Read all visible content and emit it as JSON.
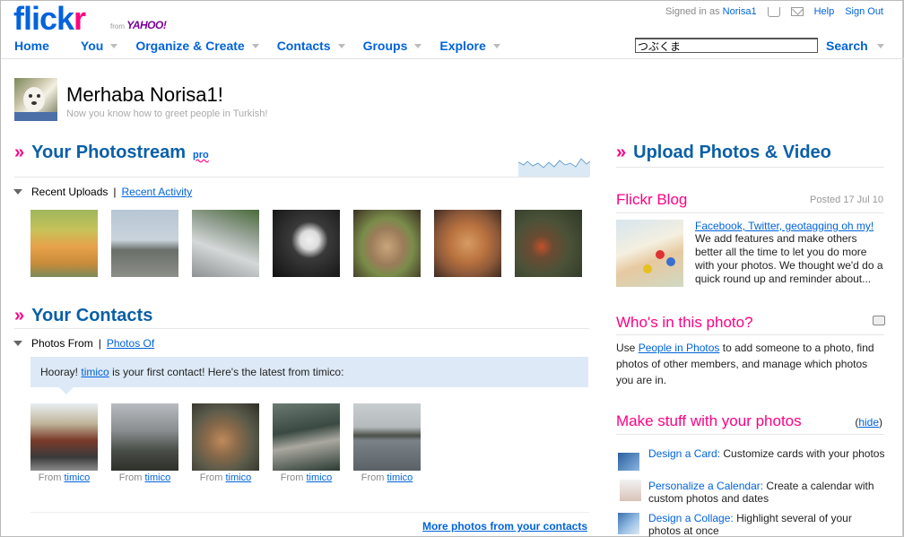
{
  "header": {
    "logo_a": "flick",
    "logo_b": "r",
    "from": "from",
    "yahoo": "YAHOO!",
    "signed_in_as": "Signed in as",
    "username": "Norisa1",
    "help": "Help",
    "sign_out": "Sign Out"
  },
  "nav": {
    "items": [
      "Home",
      "You",
      "Organize & Create",
      "Contacts",
      "Groups",
      "Explore"
    ]
  },
  "search": {
    "value": "つぶくま",
    "button": "Search"
  },
  "greeting": {
    "title": "Merhaba Norisa1!",
    "subtitle": "Now you know how to greet people in Turkish!"
  },
  "photostream": {
    "raquo": "»",
    "title": "Your Photostream",
    "pro": "pro",
    "tab_active": "Recent Uploads",
    "tab_sep": "|",
    "tab_link": "Recent Activity"
  },
  "contacts": {
    "raquo": "»",
    "title": "Your Contacts",
    "tab_active": "Photos From",
    "tab_sep": "|",
    "tab_link": "Photos Of",
    "hooray_a": "Hooray!",
    "hooray_contact": "timico",
    "hooray_b": "is your first contact! Here's the latest from timico:",
    "from_label": "From",
    "from_user": "timico",
    "more_link": "More photos from your contacts"
  },
  "right": {
    "upload_raquo": "»",
    "upload_title": "Upload Photos & Video",
    "blog_title": "Flickr Blog",
    "blog_posted": "Posted 17 Jul 10",
    "blog_link": "Facebook, Twitter, geotagging oh my!",
    "blog_text": "We add features and make others better all the time to let you do more with your photos. We thought we'd do a quick round up and reminder about...",
    "who_title": "Who's in this photo?",
    "who_a": "Use",
    "who_link": "People in Photos",
    "who_b": "to add someone to a photo, find photos of other members, and manage which photos you are in.",
    "make_title": "Make stuff with your photos",
    "hide_open": "(",
    "hide": "hide",
    "hide_close": ")",
    "make_items": [
      {
        "link": "Design a Card:",
        "text": "Customize cards with your photos"
      },
      {
        "link": "Personalize a Calendar:",
        "text": "Create a calendar with custom photos and dates"
      },
      {
        "link": "Design a Collage:",
        "text": "Highlight several of your photos at once"
      }
    ]
  },
  "colors": {
    "brand_blue": "#0063dc",
    "brand_pink": "#ff0084",
    "heading_blue": "#0a5fa8",
    "contact_bubble": "#dde9f6"
  }
}
